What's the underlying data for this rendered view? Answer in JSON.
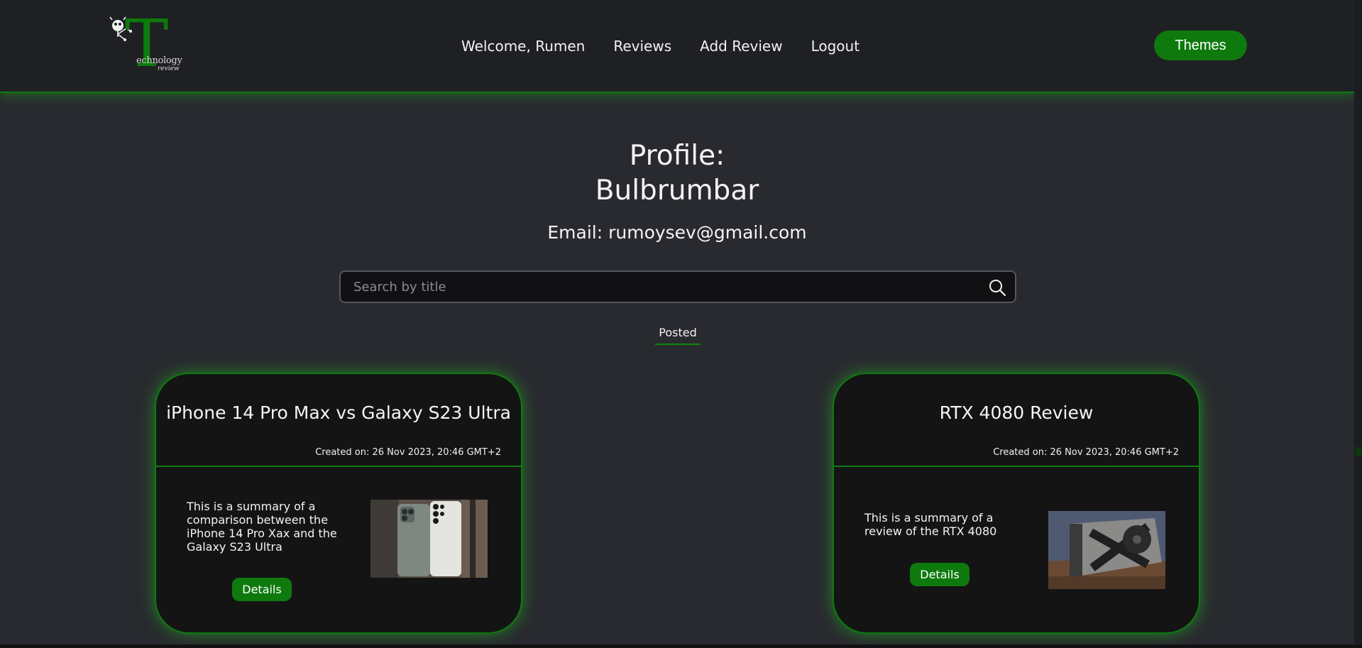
{
  "header": {
    "logo": {
      "letter": "T",
      "word": "echnology",
      "sub": "review"
    },
    "nav": [
      {
        "label": "Welcome, Rumen"
      },
      {
        "label": "Reviews"
      },
      {
        "label": "Add Review"
      },
      {
        "label": "Logout"
      }
    ],
    "themes_label": "Themes"
  },
  "profile": {
    "label": "Profile:",
    "name": "Bulbrumbar",
    "email": "Email: rumoysev@gmail.com"
  },
  "search": {
    "placeholder": "Search by title",
    "value": ""
  },
  "tabs": {
    "posted": "Posted"
  },
  "reviews": [
    {
      "title": "iPhone 14 Pro Max vs Galaxy S23 Ultra",
      "created": "Created on: 26 Nov 2023, 20:46 GMT+2",
      "summary": "This is a summary of a comparison between the iPhone 14 Pro Xax and the Galaxy S23 Ultra",
      "details_label": "Details",
      "image": "two-phones-photo"
    },
    {
      "title": "RTX 4080 Review",
      "created": "Created on: 26 Nov 2023, 20:46 GMT+2",
      "summary": "This is a summary of a review of the RTX 4080",
      "details_label": "Details",
      "image": "graphics-card-photo"
    }
  ],
  "colors": {
    "accent": "#0e7a0e",
    "background": "#292a2f",
    "header": "#1f2024",
    "card": "#141415"
  }
}
